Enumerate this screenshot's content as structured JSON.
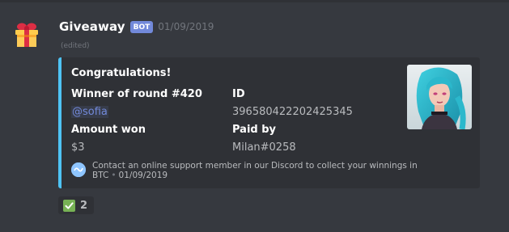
{
  "message": {
    "author": "Giveaway",
    "bot_tag": "BOT",
    "timestamp": "01/09/2019",
    "edited": "(edited)",
    "avatar_icon": "gift-icon"
  },
  "embed": {
    "accent_color": "#4ec3f4",
    "title": "Congratulations!",
    "fields": [
      {
        "name": "Winner of round #420",
        "value": "@sofia",
        "is_mention": true
      },
      {
        "name": "ID",
        "value": "396580422202425345"
      },
      {
        "name": "Amount won",
        "value": "$3"
      },
      {
        "name": "Paid by",
        "value": "Milan#0258"
      }
    ],
    "thumbnail": "anime-character-portrait",
    "footer": {
      "icon": "service-logo-icon",
      "text": "Contact an online support member in our Discord to collect your winnings in BTC",
      "separator": "•",
      "timestamp": "01/09/2019"
    }
  },
  "reaction": {
    "emoji": "check-mark-icon",
    "count": "2"
  },
  "colors": {
    "background": "#36393f",
    "embed_bg": "#2f3136",
    "mention": "#7289da",
    "bot_tag": "#7289da"
  }
}
